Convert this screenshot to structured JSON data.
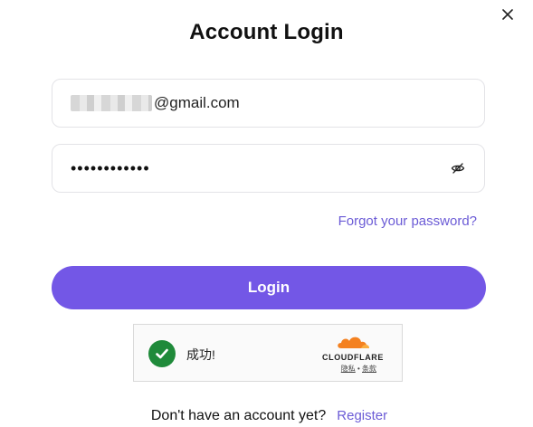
{
  "dialog": {
    "title": "Account Login",
    "close_label": "×"
  },
  "form": {
    "email_suffix": "@gmail.com",
    "password_masked": "••••••••••••",
    "forgot_label": "Forgot your password?",
    "login_label": "Login"
  },
  "captcha": {
    "status_text": "成功!",
    "brand": "CLOUDFLARE",
    "privacy_label": "隐私",
    "separator": " • ",
    "terms_label": "条款"
  },
  "footer": {
    "prompt": "Don't have an account yet?",
    "register_label": "Register"
  },
  "colors": {
    "accent": "#7357e6",
    "link": "#6b5bd6",
    "success": "#1f8a3a",
    "cloudflare_orange": "#f48120"
  }
}
